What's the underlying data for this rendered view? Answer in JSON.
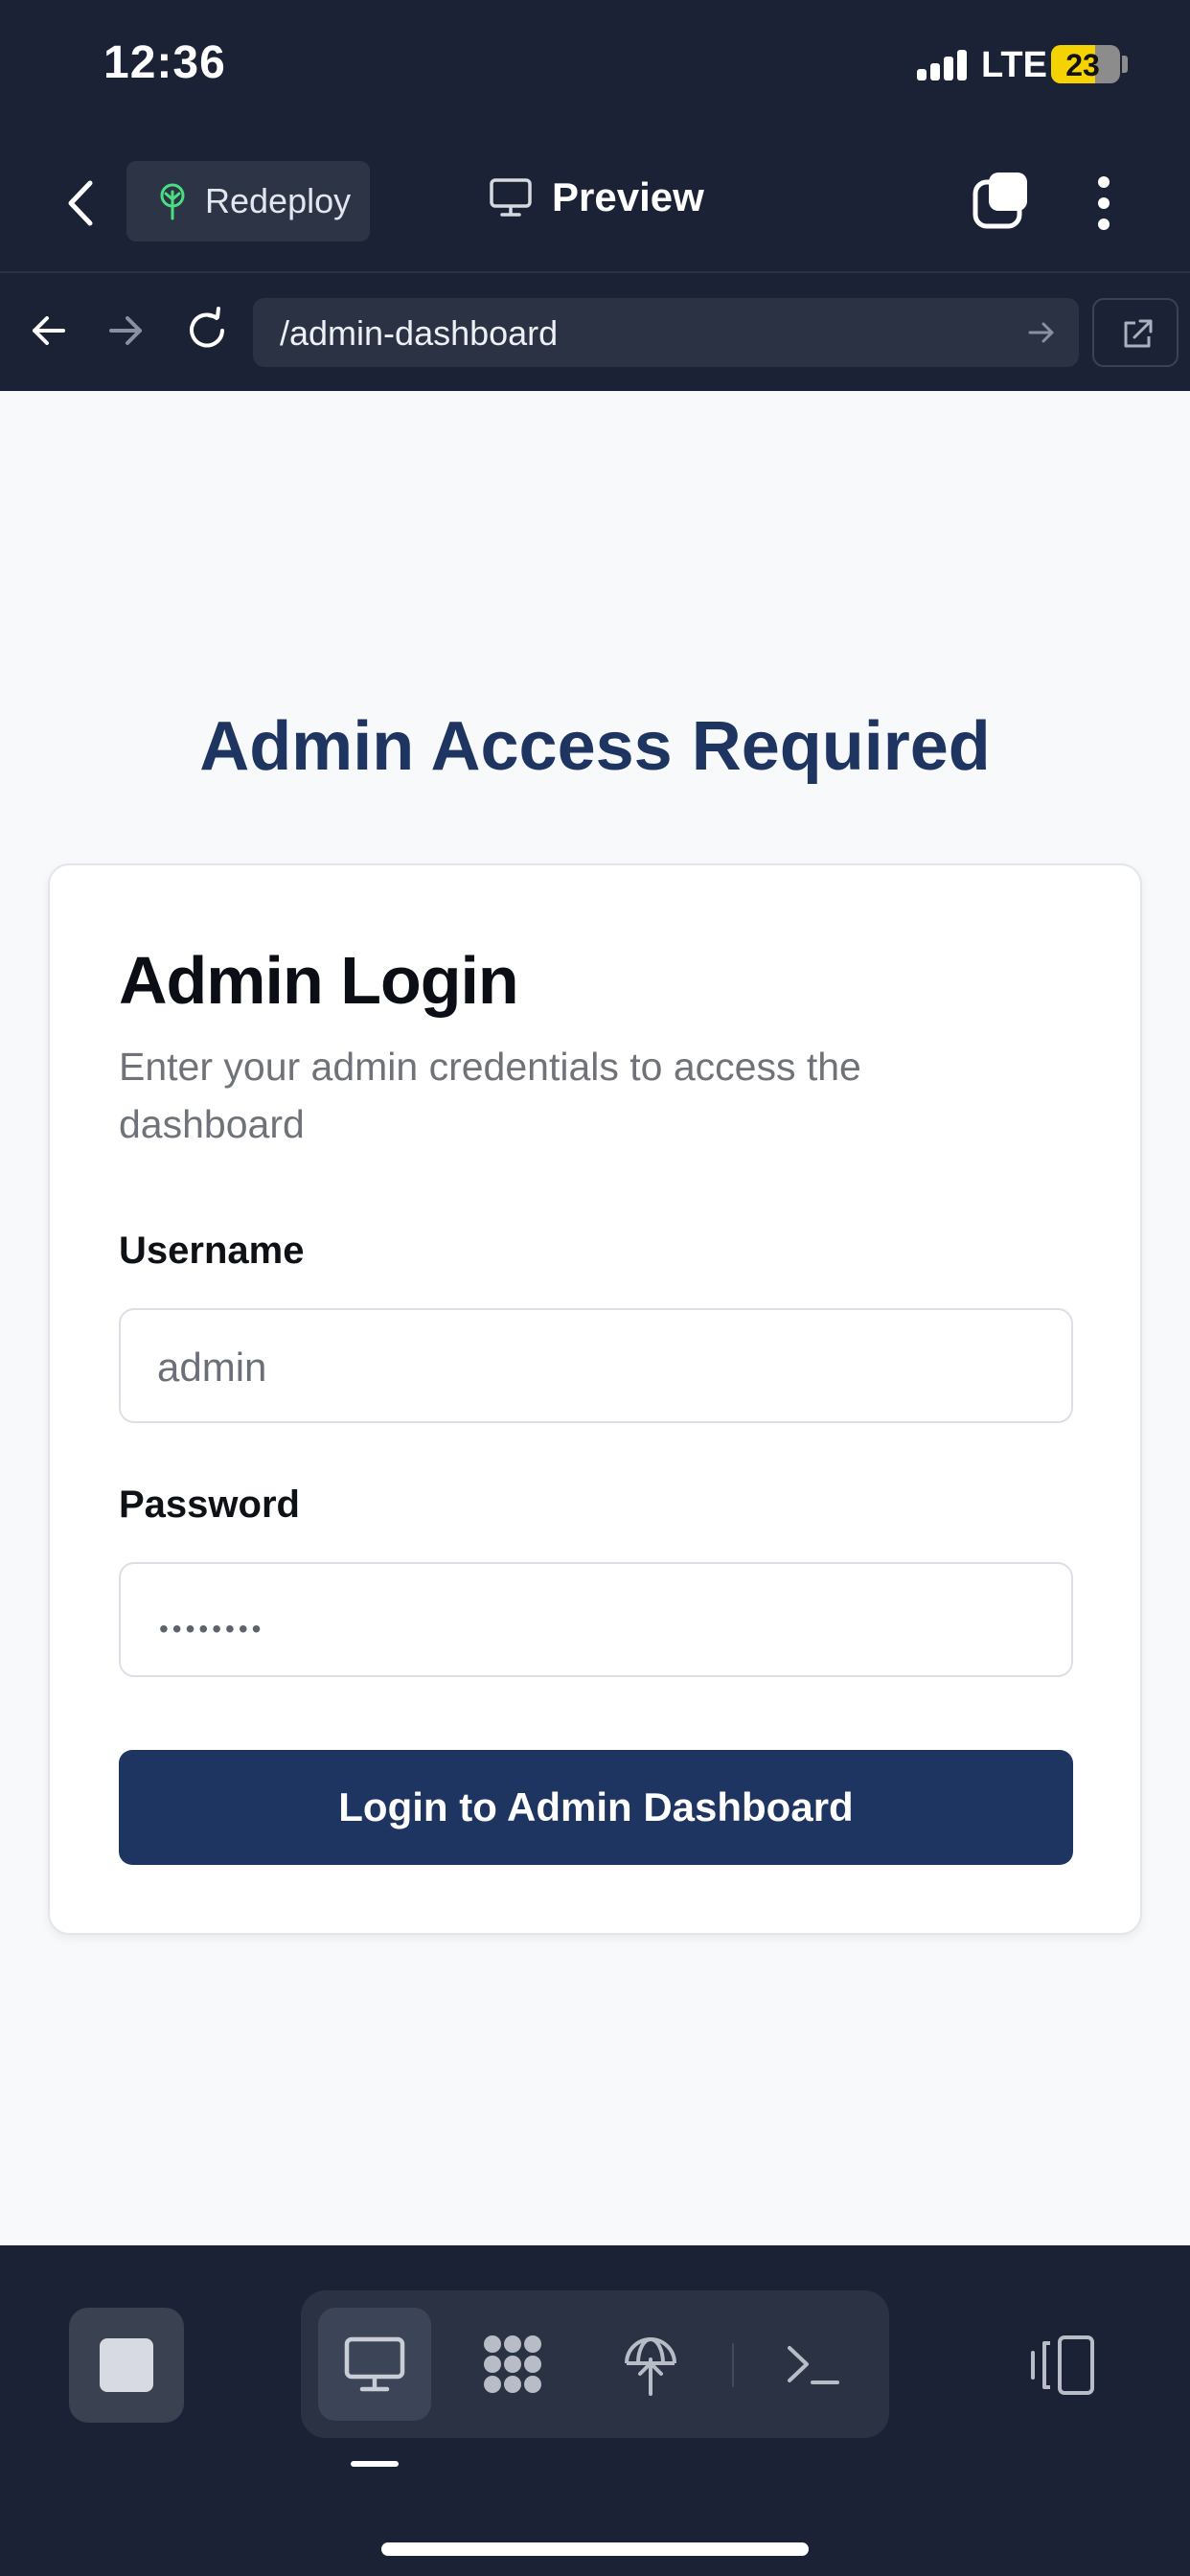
{
  "status_bar": {
    "time": "12:36",
    "network": "LTE",
    "battery": "23"
  },
  "top_bar": {
    "redeploy_label": "Redeploy",
    "preview_label": "Preview"
  },
  "url_bar": {
    "url": "/admin-dashboard"
  },
  "page": {
    "heading": "Admin Access Required",
    "card": {
      "title": "Admin Login",
      "description": "Enter your admin credentials to access the dashboard",
      "username_label": "Username",
      "username_value": "admin",
      "password_label": "Password",
      "password_masked": "••••••••",
      "submit_label": "Login to Admin Dashboard"
    }
  },
  "bottom_bar": {
    "tools": [
      "monitor-icon",
      "apps-grid-icon",
      "deploy-globe-icon",
      "terminal-icon"
    ],
    "active_tool": "monitor-icon"
  },
  "colors": {
    "chrome": "#1b2235",
    "accent": "#1e3461",
    "page_bg": "#f8f9fb",
    "battery": "#f5d300"
  }
}
